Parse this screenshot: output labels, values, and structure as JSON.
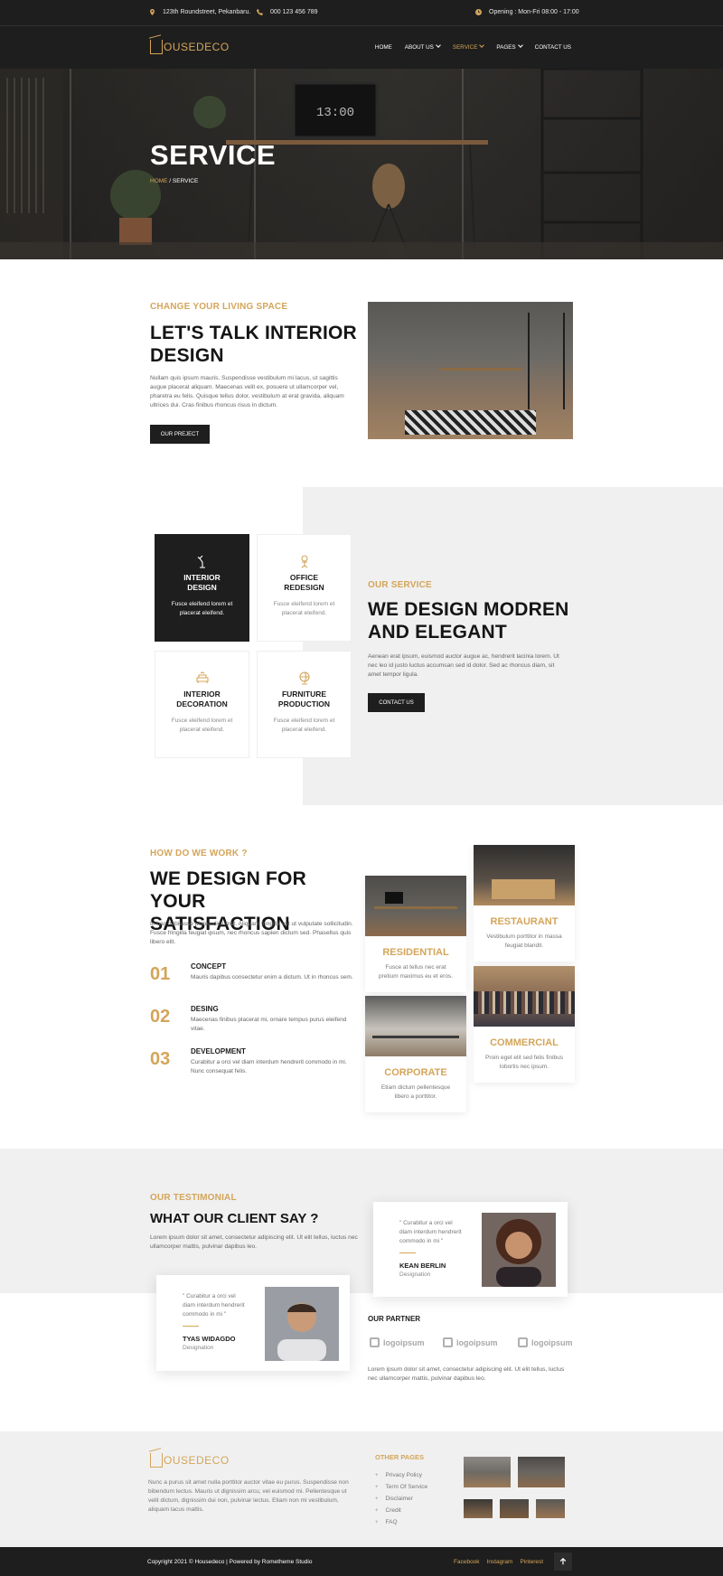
{
  "topbar": {
    "address": "123th Roundstreet, Pekanbaru.",
    "phone": "000 123 456 789",
    "hours": "Opening : Mon-Fri 08:00 - 17:00"
  },
  "brand": {
    "name": "OUSEDECO"
  },
  "nav": {
    "home": "HOME",
    "about": "ABOUT US",
    "service": "SERVICE",
    "pages": "PAGES",
    "contact": "CONTACT US"
  },
  "hero": {
    "title": "SERVICE",
    "crumb_home": "HOME",
    "crumb_sep": " / ",
    "crumb_current": "SERVICE",
    "clock": "13:00"
  },
  "about": {
    "eyebrow": "CHANGE YOUR LIVING SPACE",
    "title_line1": "LET'S TALK INTERIOR",
    "title_line2": "DESIGN",
    "text": "Nullam quis ipsum mauris. Suspendisse vestibulum mi lacus, ut sagittis augue placerat aliquam. Maecenas velit ex, posuere ut ullamcorper vel, pharetra eu felis. Quisque tellus dolor, vestibulum at erat gravida, aliquam ultrices dui. Cras finibus rhoncus risus in dictum.",
    "button": "OUR PREJECT"
  },
  "services": {
    "cards": [
      {
        "title_1": "INTERIOR",
        "title_2": "DESIGN",
        "text": "Fusce eleifend lorem et placerat eleifend.",
        "icon": "desk-lamp-icon"
      },
      {
        "title_1": "OFFICE",
        "title_2": "REDESIGN",
        "text": "Fusce eleifend lorem et placerat eleifend.",
        "icon": "office-chair-icon"
      },
      {
        "title_1": "INTERIOR",
        "title_2": "DECORATION",
        "text": "Fusce eleifend lorem et placerat eleifend.",
        "icon": "sofa-icon"
      },
      {
        "title_1": "FURNITURE",
        "title_2": "PRODUCTION",
        "text": "Fusce eleifend lorem et placerat eleifend.",
        "icon": "globe-stand-icon"
      }
    ],
    "eyebrow": "OUR SERVICE",
    "title_line1": "WE DESIGN MODREN",
    "title_line2": "AND ELEGANT",
    "text": "Aenean erat ipsum, euismod auctor augue ac, hendrerit lacinia lorem. Ut nec leo id justo luctus accumsan sed id dolor. Sed ac rhoncus diam, sit amet tempor ligula.",
    "button": "CONTACT US"
  },
  "process": {
    "eyebrow": "HOW DO WE WORK ?",
    "title_line1": "WE DESIGN FOR YOUR",
    "title_line2": "SATISFACTION",
    "text": "In hac habitasse platea dictumst. Aliquam fringilla est ut vulputate sollicitudin. Fusce fringilla feugiat ipsum, nec rhoncus sapien dictum sed. Phasellus quis libero elit.",
    "steps": [
      {
        "num": "01",
        "title": "CONCEPT",
        "text": "Mauris dapibus consectetur enim a dictum. Ut in rhoncus sem."
      },
      {
        "num": "02",
        "title": "DESING",
        "text": "Maecenas finibus placerat mi, ornare tempus purus eleifend vitae."
      },
      {
        "num": "03",
        "title": "DEVELOPMENT",
        "text": "Curabitur a orci vel diam interdum hendrerit commodo in mi. Nunc consequat felis."
      }
    ],
    "projects": [
      {
        "title": "RESIDENTIAL",
        "text": "Fusce at tellus nec erat pretium maximus eu et eros."
      },
      {
        "title": "RESTAURANT",
        "text": "Vestibulum porttitor in massa feugiat blandit."
      },
      {
        "title": "CORPORATE",
        "text": "Etiam dictum pellentesque libero a porttitor."
      },
      {
        "title": "COMMERCIAL",
        "text": "Proin eget elit sed felis finibus lobortis nec ipsum."
      }
    ]
  },
  "testimonial": {
    "eyebrow": "OUR TESTIMONIAL",
    "title": "WHAT OUR CLIENT SAY ?",
    "text": "Lorem ipsum dolor sit amet, consectetur adipiscing elit. Ut elit tellus, luctus nec ullamcorper mattis, pulvinar dapibus leo.",
    "items": [
      {
        "quote_1": "\" Curabitur a orci vel",
        "quote_2": "diam interdum hendrerit",
        "quote_3": "commodo in mi \"",
        "name": "KEAN BERLIN",
        "role": "Designation"
      },
      {
        "quote_1": "\" Curabitur a orci vel",
        "quote_2": "diam interdum hendrerit",
        "quote_3": "commodo in mi \"",
        "name": "TYAS WIDAGDO",
        "role": "Designation"
      }
    ],
    "partner_title": "OUR PARTNER",
    "partners": [
      "logoipsum",
      "logoipsum",
      "logoipsum"
    ],
    "partner_text": "Lorem ipsum dolor sit amet, consectetur adipiscing elit. Ut elit tellus, luctus nec ullamcorper mattis, pulvinar dapibus leo."
  },
  "footer": {
    "about": "Nunc a purus sit amet nulla porttitor auctor vitae eu purus. Suspendisse non bibendum lectus. Mauris ut dignissim arcu, vel euismod mi. Pellentesque ut velit dictum, dignissim dui non, pulvinar lectus. Etiam non mi vestibulum, aliquam lacus mattis.",
    "links_title": "OTHER PAGES",
    "links": [
      "Privacy Policy",
      "Term Of Service",
      "Disclaimer",
      "Credit",
      "FAQ"
    ],
    "copyright": "Copyright 2021 © Housedeco | Powered by Rometheme Studio",
    "social": [
      "Facebook",
      "Instagram",
      "Pinterest"
    ]
  },
  "colors": {
    "accent": "#d4a55a",
    "dark": "#1e1e1e",
    "light_gray": "#f0f0f0"
  }
}
